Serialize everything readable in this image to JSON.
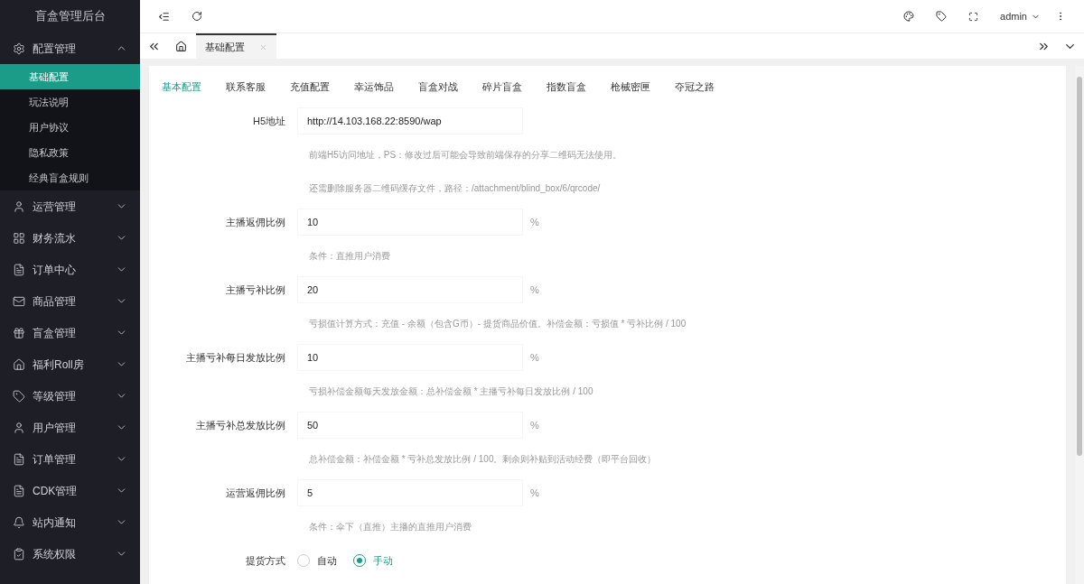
{
  "sidebar": {
    "title": "盲盒管理后台",
    "items": [
      {
        "label": "配置管理",
        "expanded": true,
        "children": [
          {
            "label": "基础配置",
            "selected": true
          },
          {
            "label": "玩法说明",
            "selected": false
          },
          {
            "label": "用户协议",
            "selected": false
          },
          {
            "label": "隐私政策",
            "selected": false
          },
          {
            "label": "经典盲盒规则",
            "selected": false
          }
        ]
      },
      {
        "label": "运营管理",
        "expanded": false
      },
      {
        "label": "财务流水",
        "expanded": false
      },
      {
        "label": "订单中心",
        "expanded": false
      },
      {
        "label": "商品管理",
        "expanded": false
      },
      {
        "label": "盲盒管理",
        "expanded": false
      },
      {
        "label": "福利Roll房",
        "expanded": false
      },
      {
        "label": "等级管理",
        "expanded": false
      },
      {
        "label": "用户管理",
        "expanded": false
      },
      {
        "label": "订单管理",
        "expanded": false
      },
      {
        "label": "CDK管理",
        "expanded": false
      },
      {
        "label": "站内通知",
        "expanded": false
      },
      {
        "label": "系统权限",
        "expanded": false
      }
    ]
  },
  "header": {
    "user": "admin"
  },
  "page_tabs": [
    {
      "label": "基础配置",
      "selected": true
    }
  ],
  "config_tabs": [
    {
      "label": "基本配置",
      "selected": true
    },
    {
      "label": "联系客服",
      "selected": false
    },
    {
      "label": "充值配置",
      "selected": false
    },
    {
      "label": "幸运饰品",
      "selected": false
    },
    {
      "label": "盲盒对战",
      "selected": false
    },
    {
      "label": "碎片盲盒",
      "selected": false
    },
    {
      "label": "指数盲盒",
      "selected": false
    },
    {
      "label": "枪械密匣",
      "selected": false
    },
    {
      "label": "夺冠之路",
      "selected": false
    }
  ],
  "form": [
    {
      "kind": "input",
      "label": "H5地址",
      "value": "http://14.103.168.22:8590/wap"
    },
    {
      "kind": "hint",
      "text": "前端H5访问地址，PS：修改过后可能会导致前端保存的分享二维码无法使用。"
    },
    {
      "kind": "hint",
      "text": "还需删除服务器二维码缓存文件，路径：/attachment/blind_box/6/qrcode/"
    },
    {
      "kind": "input",
      "label": "主播返佣比例",
      "value": "10",
      "suffix": "%"
    },
    {
      "kind": "hint",
      "text": "条件：直推用户消费"
    },
    {
      "kind": "input",
      "label": "主播亏补比例",
      "value": "20",
      "suffix": "%"
    },
    {
      "kind": "hint",
      "text": "亏损值计算方式：充值 - 余额（包含G币）- 提货商品价值。补偿金额：亏损值 * 亏补比例 / 100"
    },
    {
      "kind": "input",
      "label": "主播亏补每日发放比例",
      "value": "10",
      "suffix": "%"
    },
    {
      "kind": "hint",
      "text": "亏损补偿金额每天发放金额：总补偿金额 * 主播亏补每日发放比例 / 100"
    },
    {
      "kind": "input",
      "label": "主播亏补总发放比例",
      "value": "50",
      "suffix": "%"
    },
    {
      "kind": "hint",
      "text": "总补偿金额：补偿金额 * 亏补总发放比例 / 100。剩余则补贴到活动经费（即平台回收）"
    },
    {
      "kind": "input",
      "label": "运营返佣比例",
      "value": "5",
      "suffix": "%"
    },
    {
      "kind": "hint",
      "text": "条件：伞下（直推）主播的直推用户消费"
    },
    {
      "kind": "radio",
      "label": "提货方式",
      "options": [
        {
          "label": "自动",
          "selected": false
        },
        {
          "label": "手动",
          "selected": true
        }
      ]
    }
  ]
}
